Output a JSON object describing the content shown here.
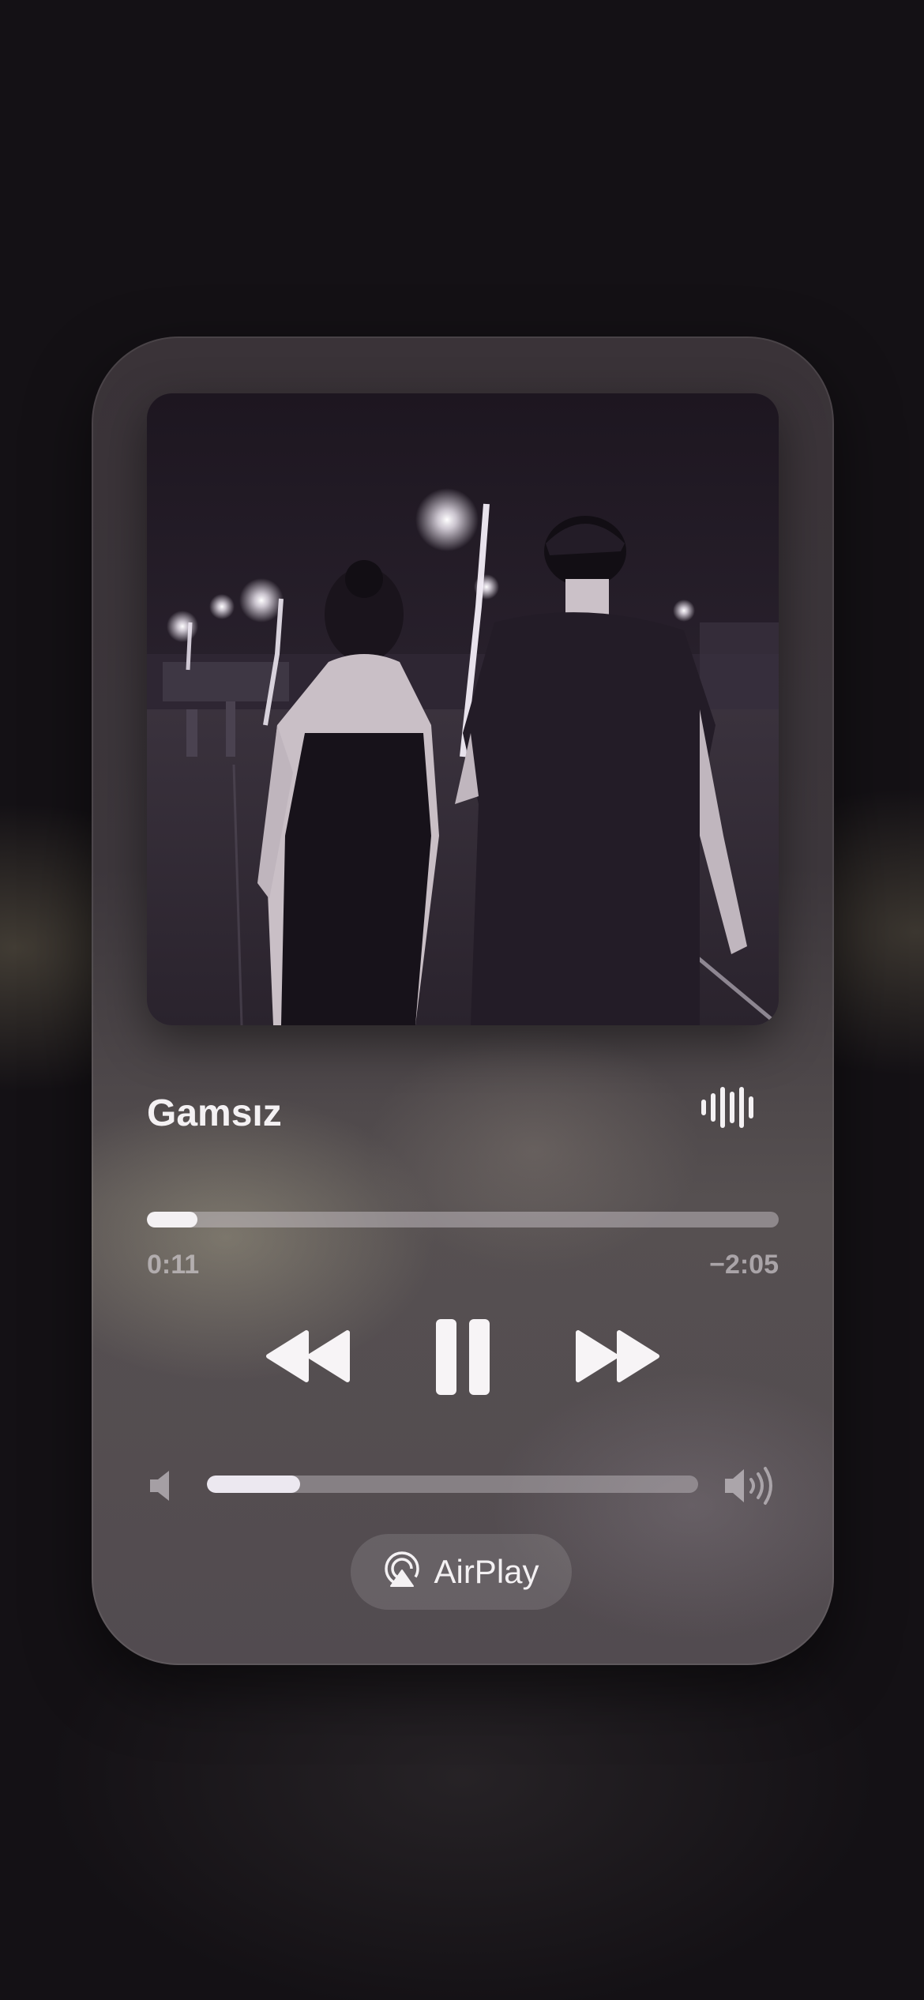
{
  "now_playing": {
    "title": "Gamsız",
    "elapsed": "0:11",
    "remaining": "−2:05",
    "progress": 0.08
  },
  "volume": {
    "level": 0.19
  },
  "controls": {
    "rewind_icon": "backward-icon",
    "pause_icon": "pause-icon",
    "forward_icon": "forward-icon",
    "waveform_icon": "waveform-icon",
    "volume_low_icon": "speaker-low-icon",
    "volume_high_icon": "speaker-high-icon"
  },
  "airplay": {
    "label": "AirPlay",
    "icon": "airplay-icon"
  },
  "colors": {
    "text_primary": "#f4f1f3",
    "text_secondary": "#d7d2d7"
  }
}
